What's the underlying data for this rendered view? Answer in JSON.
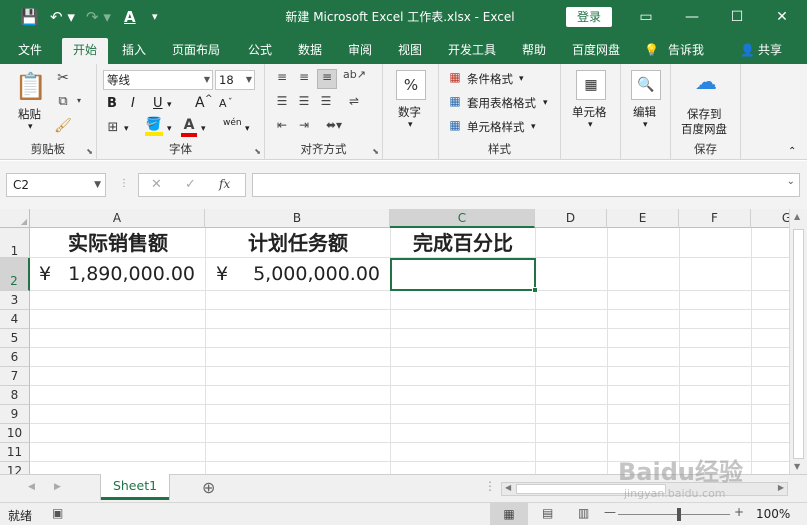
{
  "window": {
    "title": "新建 Microsoft Excel 工作表.xlsx  -  Excel",
    "login_label": "登录",
    "controls": [
      "▭",
      "—",
      "☐",
      "✕"
    ]
  },
  "quick_access": [
    "save-icon",
    "undo-icon",
    "redo-icon",
    "font-color-icon",
    "customize-icon"
  ],
  "tabs": [
    "文件",
    "开始",
    "插入",
    "页面布局",
    "公式",
    "数据",
    "审阅",
    "视图",
    "开发工具",
    "帮助",
    "百度网盘",
    "告诉我",
    "共享"
  ],
  "active_tab": "开始",
  "ribbon": {
    "clipboard": {
      "paste_label": "粘贴",
      "group_label": "剪贴板"
    },
    "font": {
      "font_name": "等线",
      "font_size": "18",
      "bold": "B",
      "italic": "I",
      "underline": "U",
      "grow": "A",
      "shrink": "A",
      "phonetic": "wén",
      "group_label": "字体"
    },
    "alignment": {
      "group_label": "对齐方式"
    },
    "number": {
      "label": "数字",
      "percent": "%"
    },
    "styles": {
      "conditional": "条件格式",
      "table_format": "套用表格格式",
      "cell_styles": "单元格样式",
      "group_label": "样式"
    },
    "cells": {
      "label": "单元格"
    },
    "editing": {
      "label": "编辑"
    },
    "save": {
      "line1": "保存到",
      "line2": "百度网盘",
      "group_label": "保存"
    }
  },
  "formula_bar": {
    "name_box": "C2",
    "cancel": "✕",
    "enter": "✓",
    "fx": "fx",
    "formula": ""
  },
  "grid": {
    "columns": [
      "A",
      "B",
      "C",
      "D",
      "E",
      "F",
      "G"
    ],
    "rows": [
      "1",
      "2",
      "3",
      "4",
      "5",
      "6",
      "7",
      "8",
      "9",
      "10",
      "11",
      "12"
    ],
    "selected_cell": "C2",
    "cells": {
      "A1": "实际销售额",
      "B1": "计划任务额",
      "C1": "完成百分比",
      "A2_symbol": "¥",
      "A2_value": "1,890,000.00",
      "B2_symbol": "¥",
      "B2_value": "5,000,000.00"
    }
  },
  "sheets": [
    "Sheet1"
  ],
  "status": {
    "ready": "就绪",
    "zoom": "100%"
  },
  "watermark": {
    "text": "Baidu经验",
    "url": "jingyan.baidu.com"
  }
}
